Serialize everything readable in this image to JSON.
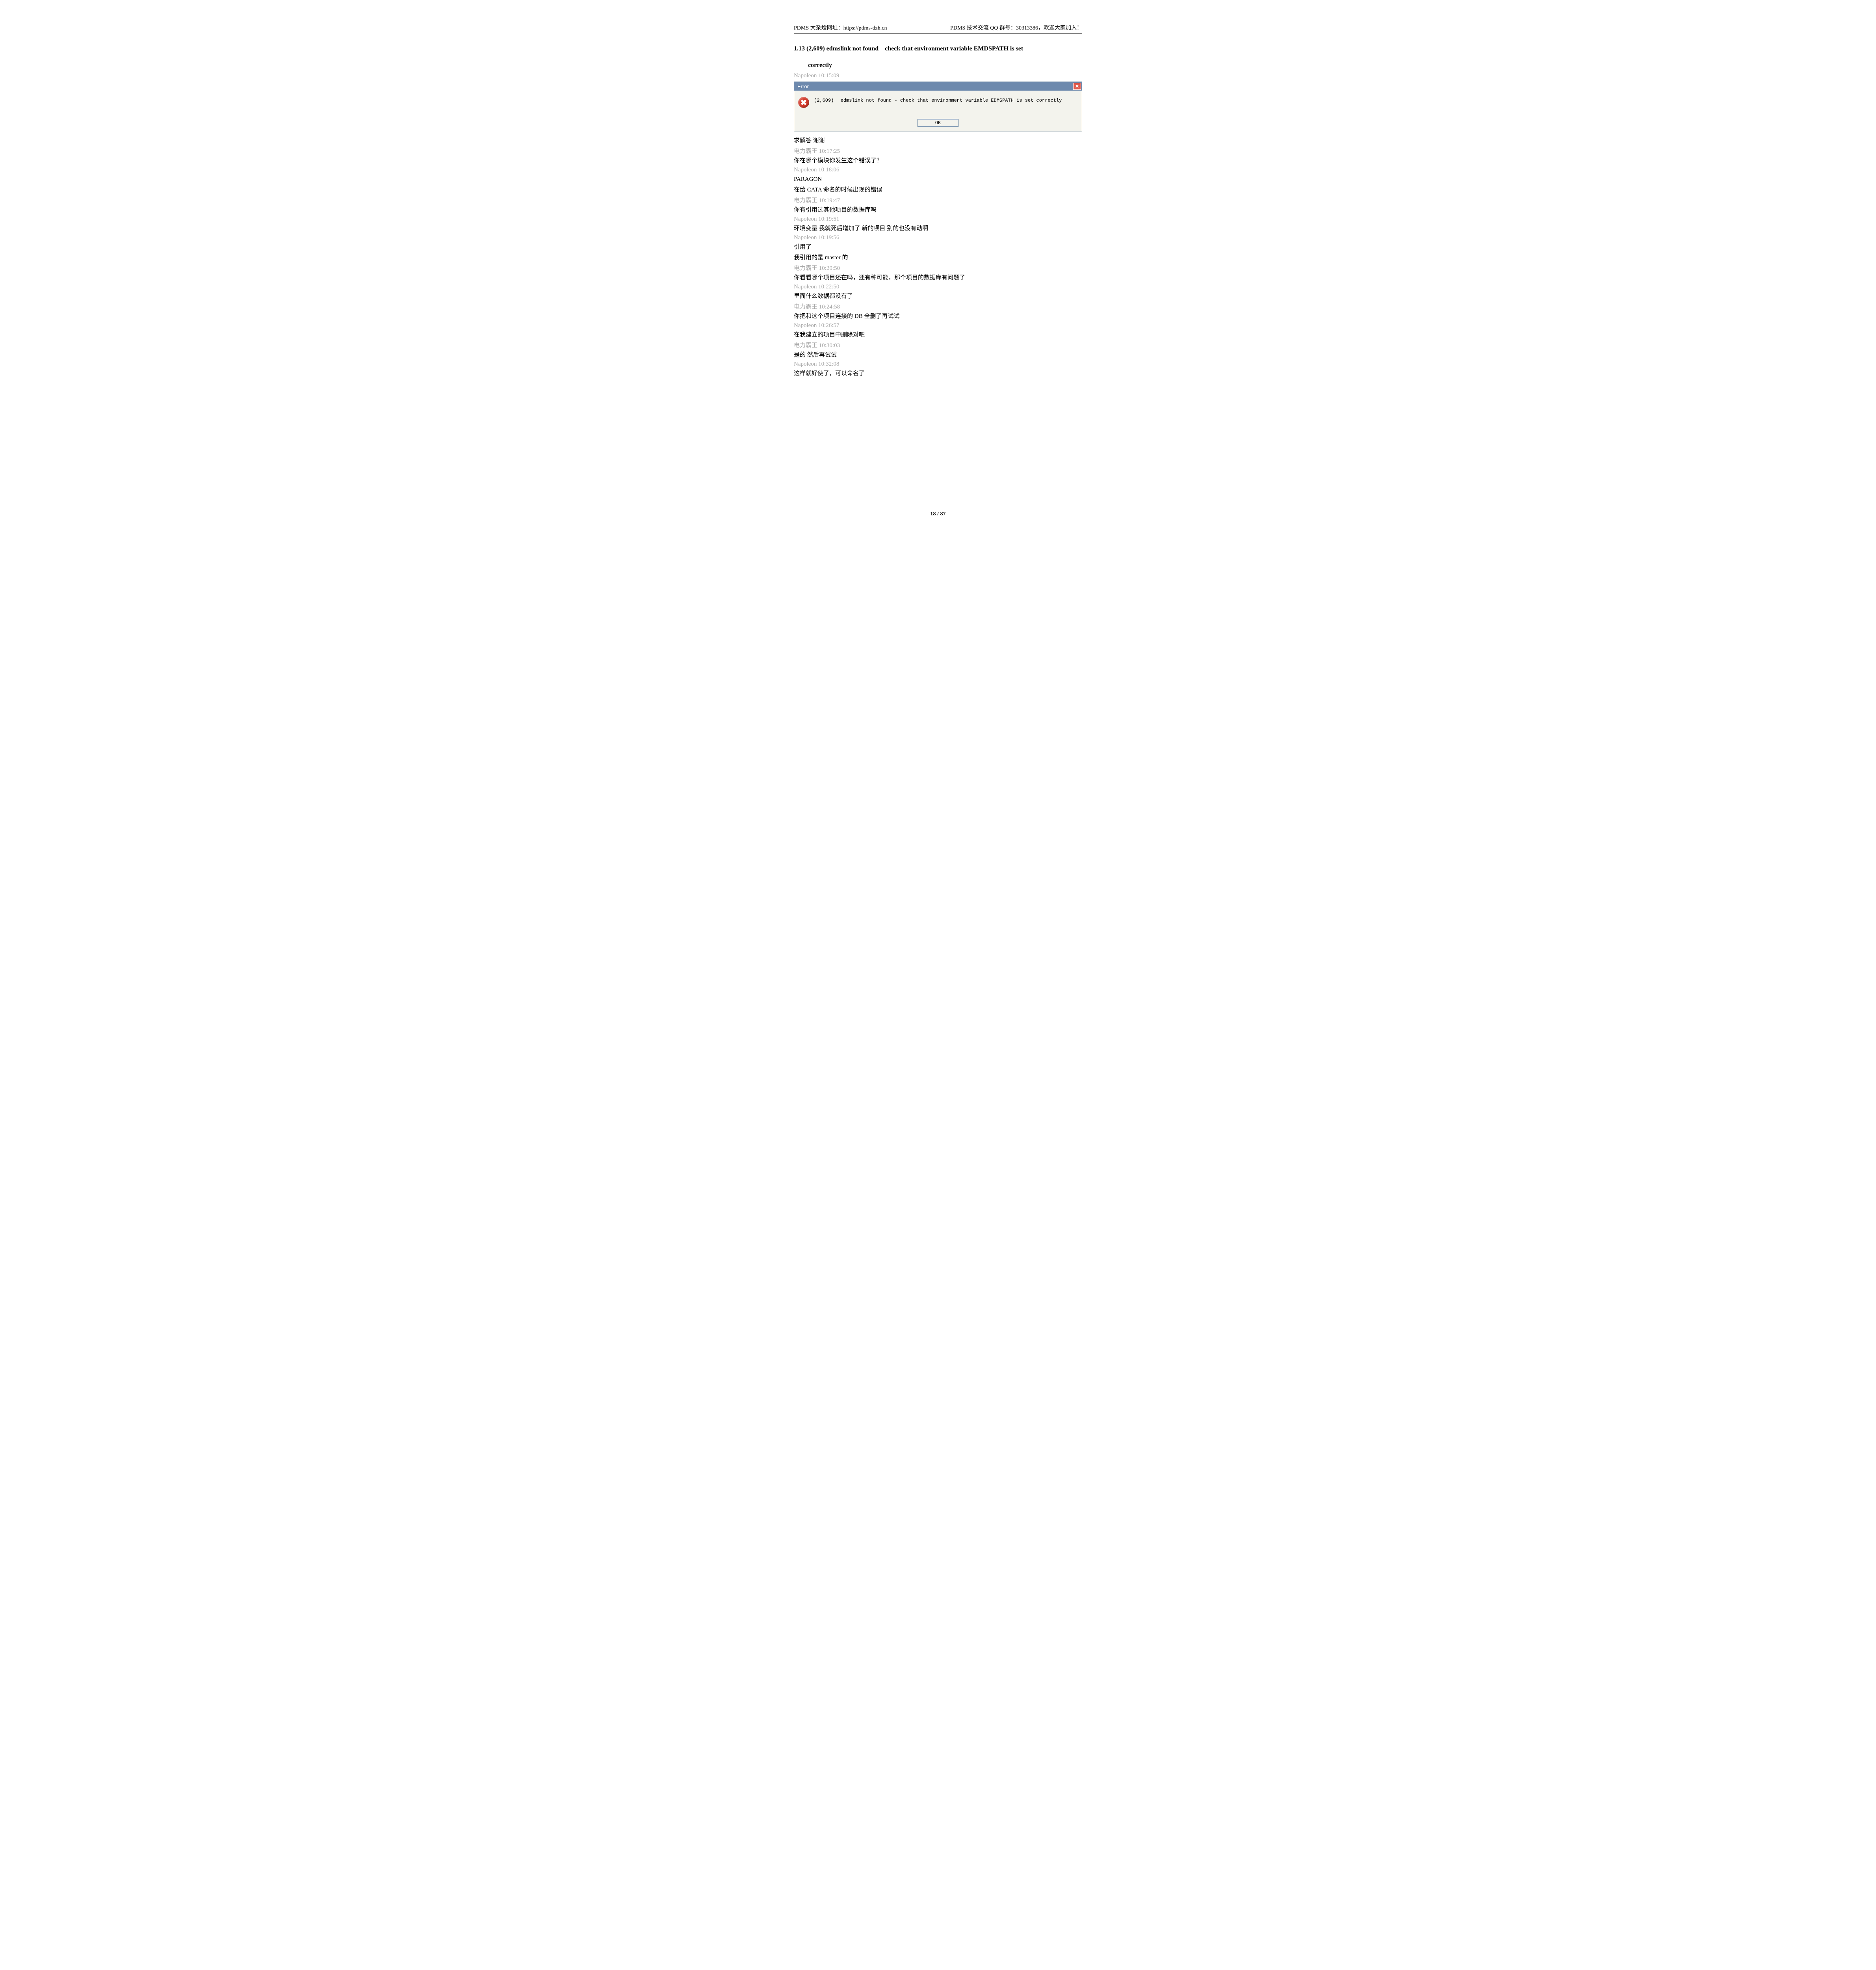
{
  "header": {
    "left": "PDMS 大杂烩网址：https://pdms-dzh.cn",
    "right": "PDMS 技术交流 QQ 群号：30313386，欢迎大家加入！"
  },
  "section": {
    "number": "1.13",
    "title_line1": "(2,609) edmslink not found – check that environment variable EMDSPATH is set",
    "title_line2": "correctly"
  },
  "first_meta": "Napoleon 10:15:09",
  "error_dialog": {
    "title": "Error",
    "code": "(2,609)",
    "message": "edmslink not found - check that environment variable EDMSPATH is set correctly",
    "ok": "OK"
  },
  "chat": [
    {
      "type": "body",
      "text": "求解答  谢谢"
    },
    {
      "type": "meta",
      "text": "电力霸王 10:17:25"
    },
    {
      "type": "body",
      "text": "你在哪个模块你发生这个错误了？"
    },
    {
      "type": "meta",
      "text": "Napoleon 10:18:06"
    },
    {
      "type": "body",
      "text": "PARAGON"
    },
    {
      "type": "body",
      "text": "在给 CATA 命名的时候出现的错误"
    },
    {
      "type": "meta",
      "text": "电力霸王 10:19:47"
    },
    {
      "type": "body",
      "text": "你有引用过其他项目的数据库吗"
    },
    {
      "type": "meta",
      "text": "Napoleon 10:19:51"
    },
    {
      "type": "body",
      "text": "环境变量 我就死后增加了 新的项目 别的也没有动啊"
    },
    {
      "type": "meta",
      "text": "Napoleon 10:19:56"
    },
    {
      "type": "body",
      "text": "引用了"
    },
    {
      "type": "body",
      "text": "我引用的是 master 的"
    },
    {
      "type": "meta",
      "text": "电力霸王 10:20:50"
    },
    {
      "type": "body",
      "text": "你看看哪个项目还在吗，还有种可能，那个项目的数据库有问题了"
    },
    {
      "type": "meta",
      "text": "Napoleon 10:22:50"
    },
    {
      "type": "body",
      "text": "里面什么数据都没有了"
    },
    {
      "type": "meta",
      "text": "电力霸王 10:24:58"
    },
    {
      "type": "body",
      "text": "你把和这个项目连接的 DB 全删了再试试"
    },
    {
      "type": "meta",
      "text": "Napoleon 10:26:57"
    },
    {
      "type": "body",
      "text": "在我建立的项目中删除对吧"
    },
    {
      "type": "meta",
      "text": "电力霸王 10:30:03"
    },
    {
      "type": "body",
      "text": "是的 然后再试试"
    },
    {
      "type": "meta",
      "text": "Napoleon 10:32:08"
    },
    {
      "type": "body",
      "text": "这样就好使了，可以命名了"
    }
  ],
  "footer": {
    "page": "18",
    "sep": " / ",
    "total": "87"
  }
}
